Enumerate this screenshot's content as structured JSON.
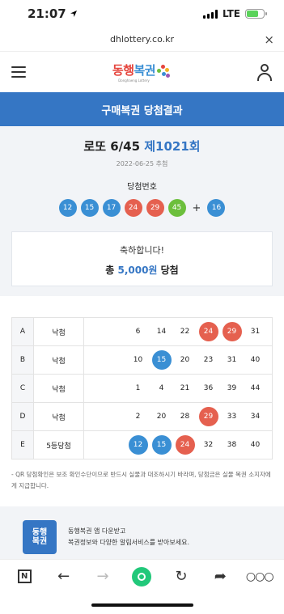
{
  "status_bar": {
    "time": "21:07",
    "network": "LTE"
  },
  "browser": {
    "url": "dhlottery.co.kr",
    "close_glyph": "×"
  },
  "header": {
    "logo_text_red": "동행",
    "logo_text_blue": "복권",
    "logo_sub": "Donghaeng Lottery"
  },
  "page_title": "구매복권 당첨결과",
  "draw": {
    "game": "로또 6/45 ",
    "round": "제1021회",
    "date": "2022-06-25 추첨",
    "win_label": "당첨번호",
    "numbers": [
      {
        "value": "12",
        "color": "#3a8fd4"
      },
      {
        "value": "15",
        "color": "#3a8fd4"
      },
      {
        "value": "17",
        "color": "#3a8fd4"
      },
      {
        "value": "24",
        "color": "#e5604f"
      },
      {
        "value": "29",
        "color": "#e5604f"
      },
      {
        "value": "45",
        "color": "#6cbf3c"
      }
    ],
    "plus": "+",
    "bonus": {
      "value": "16",
      "color": "#3a8fd4"
    }
  },
  "congrats": {
    "message": "축하합니다!",
    "total_prefix": "총 ",
    "amount": "5,000원",
    "total_suffix": " 당첨"
  },
  "results": [
    {
      "label": "A",
      "status": "낙첨",
      "numbers": [
        {
          "v": "6"
        },
        {
          "v": "14"
        },
        {
          "v": "22"
        },
        {
          "v": "24",
          "color": "#e5604f"
        },
        {
          "v": "29",
          "color": "#e5604f"
        },
        {
          "v": "31"
        }
      ]
    },
    {
      "label": "B",
      "status": "낙첨",
      "numbers": [
        {
          "v": "10"
        },
        {
          "v": "15",
          "color": "#3a8fd4"
        },
        {
          "v": "20"
        },
        {
          "v": "23"
        },
        {
          "v": "31"
        },
        {
          "v": "40"
        }
      ]
    },
    {
      "label": "C",
      "status": "낙첨",
      "numbers": [
        {
          "v": "1"
        },
        {
          "v": "4"
        },
        {
          "v": "21"
        },
        {
          "v": "36"
        },
        {
          "v": "39"
        },
        {
          "v": "44"
        }
      ]
    },
    {
      "label": "D",
      "status": "낙첨",
      "numbers": [
        {
          "v": "2"
        },
        {
          "v": "20"
        },
        {
          "v": "28"
        },
        {
          "v": "29",
          "color": "#e5604f"
        },
        {
          "v": "33"
        },
        {
          "v": "34"
        }
      ]
    },
    {
      "label": "E",
      "status": "5등당첨",
      "numbers": [
        {
          "v": "12",
          "color": "#3a8fd4"
        },
        {
          "v": "15",
          "color": "#3a8fd4"
        },
        {
          "v": "24",
          "color": "#e5604f"
        },
        {
          "v": "32"
        },
        {
          "v": "38"
        },
        {
          "v": "40"
        }
      ]
    }
  ],
  "notice": "- QR 당첨확인은 보조 확인수단이므로 반드시 실물과 대조하시기 바라며, 당첨금은 실물 복권 소지자에게 지급합니다.",
  "promo": {
    "logo": "동행\n복권",
    "line1": "동행복권 앱 다운받고",
    "line2": "복권정보와 다양한 알림서비스를 받아보세요."
  },
  "toolbar": {
    "n_label": "N",
    "back": "←",
    "forward": "→",
    "reload": "↻",
    "share": "➦",
    "more": "○○○"
  }
}
